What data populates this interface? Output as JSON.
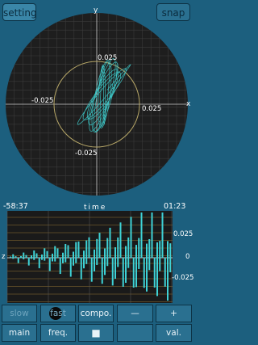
{
  "toolbar": {
    "setting_label": "setting",
    "snap_label": "snap",
    "y_axis_label": "y",
    "x_axis_label": "x"
  },
  "scope": {
    "ticks": {
      "top": "0.025",
      "left": "-0.025",
      "right": "0.025",
      "bottom": "-0.025"
    },
    "colors": {
      "background": "#1c5f7e",
      "disk": "#1e1e1e",
      "grid": "#3b3b3b",
      "circle": "#b8a868",
      "trace": "#3fd0d0"
    }
  },
  "timechart": {
    "start_time": "-58:37",
    "title": "time",
    "end_time": "01:23",
    "axis_label": "z",
    "tick_pos": "0.025",
    "tick_zero": "0",
    "tick_neg": "-0.025",
    "colors": {
      "bars": "#3ed2d6",
      "grid": "#b08a3a",
      "panel": "#1a1a1a"
    }
  },
  "buttons": {
    "row1": {
      "slow": "slow",
      "fast": "fast",
      "compo": "compo.",
      "minus": "—",
      "plus": "+"
    },
    "row2": {
      "main": "main",
      "freq": "freq.",
      "stop": "■",
      "val": "val."
    }
  },
  "colors": {
    "highlight": "#0a0a0a",
    "button": "#2a7090"
  }
}
